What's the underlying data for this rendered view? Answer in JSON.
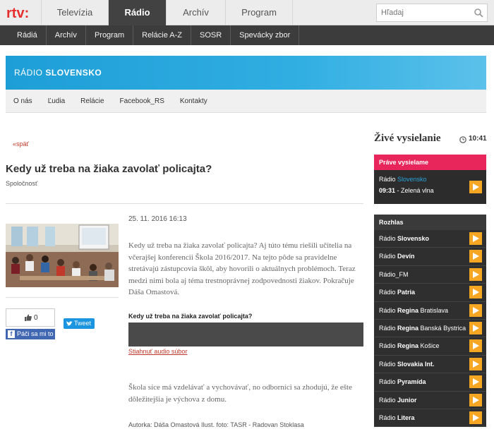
{
  "header": {
    "logo_text": "rtv:",
    "tabs": [
      {
        "label": "Televízia",
        "active": false
      },
      {
        "label": "Rádio",
        "active": true
      },
      {
        "label": "Archív",
        "active": false
      },
      {
        "label": "Program",
        "active": false
      }
    ],
    "search_placeholder": "Hľadaj"
  },
  "subnav": [
    "Rádiá",
    "Archív",
    "Program",
    "Relácie A-Z",
    "SOSR",
    "Spevácky zbor"
  ],
  "banner": {
    "prefix": "RÁDIO",
    "name": "SLOVENSKO"
  },
  "station_nav": [
    "O nás",
    "Ľudia",
    "Relácie",
    "Facebook_RS",
    "Kontakty"
  ],
  "article": {
    "back": "«späť",
    "title": "Kedy už treba na žiaka zavolať policajta?",
    "category": "Spoločnosť",
    "date": "25. 11. 2016 16:13",
    "lead": "Kedy už treba na žiaka zavolať policajta? Aj túto tému riešili učitelia na včerajšej konferencii Škola 2016/2017. Na tejto pôde sa pravidelne stretávajú zástupcovia škôl, aby hovorili o aktuálnych problémoch. Teraz medzi nimi bola aj téma trestnoprávnej zodpovednosti žiakov. Pokračuje Dáša Omastová.",
    "audio_title": "Kedy už treba na žiaka zavolať policajta?",
    "download": "Stiahnuť audio súbor",
    "body": "Škola síce má vzdelávať a vychovávať, no odborníci sa zhodujú, že ešte dôležitejšia je výchova z domu.",
    "credit": "Autorka: Dáša Omastová Ilust. foto: TASR - Radovan Stoklasa"
  },
  "social": {
    "like_count": "0",
    "fb_label": "Páči sa mi to",
    "tweet_label": "Tweet"
  },
  "live": {
    "title": "Živé vysielanie",
    "time": "10:41",
    "now_head": "Práve vysielame",
    "station_prefix": "Rádio",
    "station_name": "Slovensko",
    "program_time": "09:31",
    "program_name": "- Zelená vlna"
  },
  "rozhlas": {
    "head": "Rozhlas",
    "stations": [
      {
        "prefix": "Rádio",
        "bold": "Slovensko",
        "suffix": ""
      },
      {
        "prefix": "Rádio",
        "bold": "Devín",
        "suffix": ""
      },
      {
        "prefix": "Rádio_FM",
        "bold": "",
        "suffix": ""
      },
      {
        "prefix": "Rádio",
        "bold": "Patria",
        "suffix": ""
      },
      {
        "prefix": "Rádio",
        "bold": "Regina",
        "suffix": " Bratislava"
      },
      {
        "prefix": "Rádio",
        "bold": "Regina",
        "suffix": " Banská Bystrica"
      },
      {
        "prefix": "Rádio",
        "bold": "Regina",
        "suffix": " Košice"
      },
      {
        "prefix": "Rádio",
        "bold": "Slovakia Int.",
        "suffix": ""
      },
      {
        "prefix": "Rádio",
        "bold": "Pyramída",
        "suffix": ""
      },
      {
        "prefix": "Rádio",
        "bold": "Junior",
        "suffix": ""
      },
      {
        "prefix": "Rádio",
        "bold": "Litera",
        "suffix": ""
      }
    ]
  },
  "colors": {
    "accent": "#e8265c",
    "brand_red": "#e52e2e",
    "banner_blue": "#1e9ed7",
    "play_orange": "#f5a623"
  }
}
